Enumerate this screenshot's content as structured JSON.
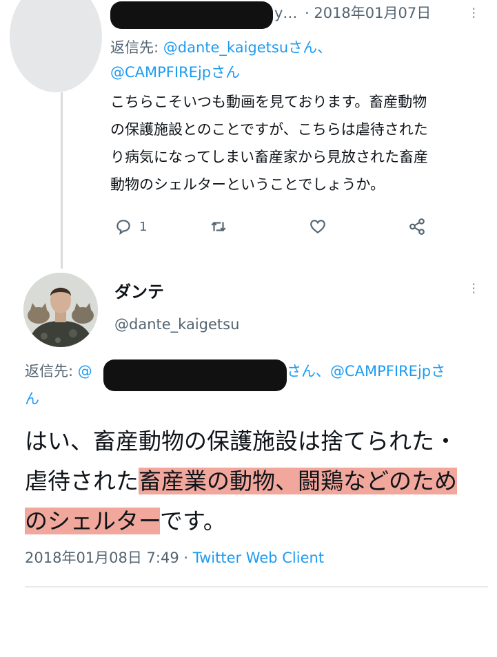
{
  "tweet1": {
    "header_suffix": "y…",
    "date": "· 2018年01月07日",
    "reply_prefix": "返信先: ",
    "reply_handle1": "@dante_kaigetsuさん、",
    "reply_handle2": "@CAMPFIREjpさん",
    "body_lines": [
      "こちらこそいつも動画を見ております。畜産動物",
      "の保護施設とのことですが、こちらは虐待された",
      "り病気になってしまい畜産家から見放された畜産",
      "動物のシェルターということでしょうか。"
    ],
    "reply_count": "1"
  },
  "tweet2": {
    "display_name": "ダンテ",
    "handle": "@dante_kaigetsu",
    "reply_prefix": "返信先: ",
    "reply_handle_start": "@",
    "reply_after_redaction": "さん、",
    "reply_handle2": "@CAMPFIREjpさ",
    "reply_wrap": "ん",
    "body": {
      "line1": "はい、畜産動物の保護施設は捨てられた・",
      "line2_plain": "虐待された",
      "line2_highlight": "畜産業の動物、闘鶏などのため",
      "line3_highlight": "のシェルター",
      "line3_plain": "です。"
    },
    "timestamp": "2018年01月08日 7:49 · ",
    "client": "Twitter Web Client"
  },
  "colors": {
    "link": "#1d9bf0",
    "muted": "#536471",
    "highlight": "#f2a79c",
    "redaction": "#111111"
  },
  "icons": [
    "reply-icon",
    "retweet-icon",
    "like-icon",
    "share-icon",
    "more-icon"
  ]
}
